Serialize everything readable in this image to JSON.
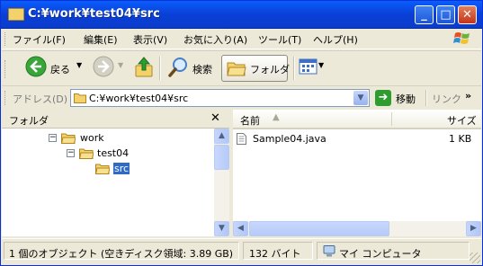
{
  "window": {
    "title": "C:¥work¥test04¥src"
  },
  "menu": {
    "items": [
      "ファイル(F)",
      "編集(E)",
      "表示(V)",
      "お気に入り(A)",
      "ツール(T)",
      "ヘルプ(H)"
    ]
  },
  "toolbar": {
    "back_label": "戻る",
    "search_label": "検索",
    "folders_label": "フォルダ"
  },
  "address": {
    "label": "アドレス(D)",
    "value": "C:¥work¥test04¥src",
    "go_label": "移動",
    "links_label": "リンク"
  },
  "tree": {
    "title": "フォルダ",
    "nodes": [
      {
        "label": "work",
        "expander": "−",
        "selected": false
      },
      {
        "label": "test04",
        "expander": "−",
        "selected": false
      },
      {
        "label": "src",
        "expander": "",
        "selected": true
      }
    ]
  },
  "list": {
    "col_name": "名前",
    "col_size": "サイズ",
    "files": [
      {
        "name": "Sample04.java",
        "size": "1 KB"
      }
    ]
  },
  "status": {
    "objects": "1 個のオブジェクト (空きディスク領域: 3.89 GB)",
    "size": "132 バイト",
    "location": "マイ コンピュータ"
  },
  "colors": {
    "title_bar": "#0a4ee8",
    "selection": "#316ac5",
    "folder": "#f3d26b",
    "go_button": "#2e9c2e"
  }
}
